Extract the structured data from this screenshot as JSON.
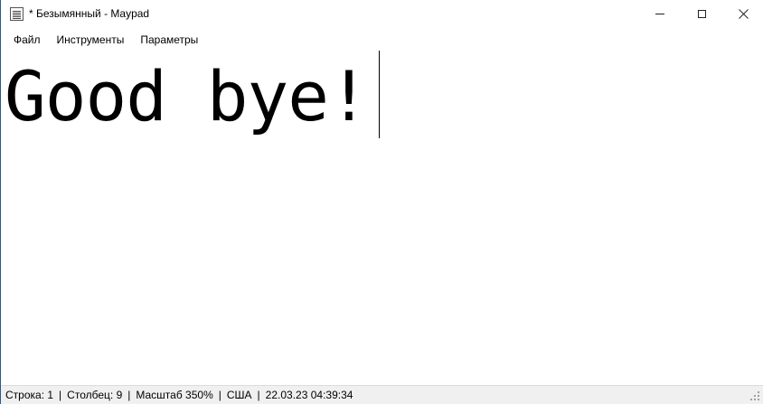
{
  "window": {
    "title": "* Безымянный - Maypad",
    "icon": "notepad-lines-icon"
  },
  "menu": {
    "items": [
      "Файл",
      "Инструменты",
      "Параметры"
    ]
  },
  "editor": {
    "text": "Good bye!"
  },
  "status": {
    "row": "Строка: 1",
    "column": "Столбец: 9",
    "zoom": "Масштаб 350%",
    "locale": "США",
    "datetime": "22.03.23 04:39:34",
    "separator": "|"
  }
}
